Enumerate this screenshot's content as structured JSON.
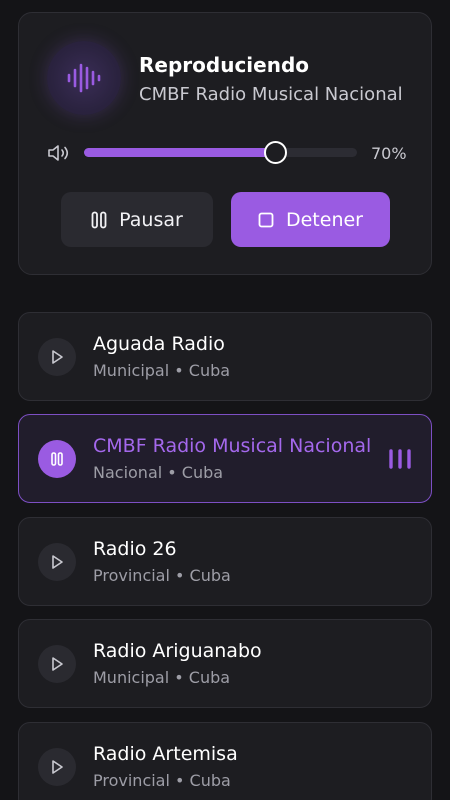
{
  "now_playing": {
    "title": "Reproduciendo",
    "station": "CMBF Radio Musical Nacional",
    "volume_percent": 70,
    "volume_label": "70%",
    "pause_label": "Pausar",
    "stop_label": "Detener",
    "accent_color": "#9a5be2",
    "icons": [
      "waveform-icon",
      "speaker-icon",
      "pause-icon",
      "stop-icon"
    ]
  },
  "stations": [
    {
      "name": "Aguada Radio",
      "meta": "Municipal • Cuba",
      "active": false
    },
    {
      "name": "CMBF Radio Musical Nacional",
      "meta": "Nacional • Cuba",
      "active": true
    },
    {
      "name": "Radio 26",
      "meta": "Provincial • Cuba",
      "active": false
    },
    {
      "name": "Radio Ariguanabo",
      "meta": "Municipal • Cuba",
      "active": false
    },
    {
      "name": "Radio Artemisa",
      "meta": "Provincial • Cuba",
      "active": false
    }
  ]
}
